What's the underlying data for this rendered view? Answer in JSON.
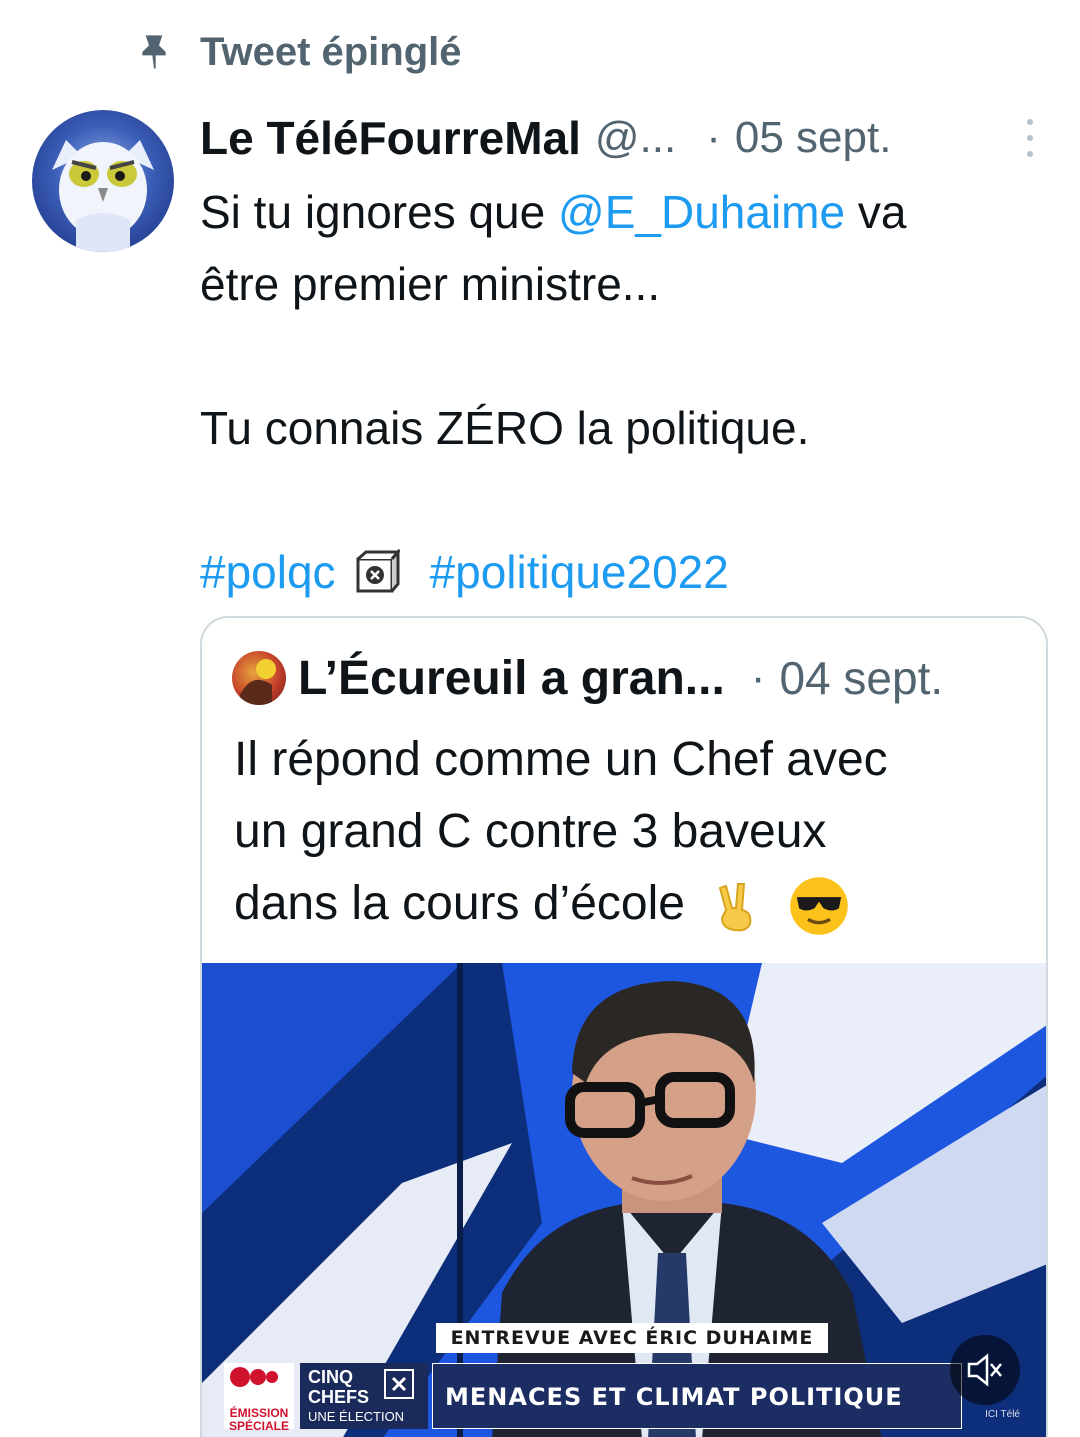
{
  "pinned": {
    "label": "Tweet épinglé",
    "icon": "pin-icon"
  },
  "tweet": {
    "author_name": "Le TéléFourreMal",
    "author_handle": "@...",
    "separator": "·",
    "date": "05 sept.",
    "text_line1_before": "Si tu ignores que ",
    "mention": "@E_Duhaime",
    "text_line1_after": " va",
    "text_line2": "être premier ministre...",
    "text_line3": "Tu connais ZÉRO la politique.",
    "hashtag1": "#polqc",
    "hashtag2": "#politique2022",
    "colors": {
      "link": "#1d9bf0",
      "secondary": "#536471"
    }
  },
  "quote": {
    "author_name": "L’Écureuil a gran...",
    "separator": "·",
    "date": "04 sept.",
    "line1": "Il répond comme un Chef avec",
    "line2": "un grand C contre 3 baveux",
    "line3": "dans la cours d’école",
    "emojis": [
      "victory-hand-emoji",
      "sunglasses-emoji"
    ]
  },
  "media": {
    "banner_top": "ENTREVUE AVEC ÉRIC DUHAIME",
    "banner_main": "MENACES ET CLIMAT POLITIQUE",
    "logo_text": "ÉMISSION SPÉCIALE",
    "show_title": "CINQ CHEFS",
    "show_subtitle": "UNE ÉLECTION",
    "network": "ICI Télé",
    "mute_icon": "speaker-muted-icon"
  }
}
